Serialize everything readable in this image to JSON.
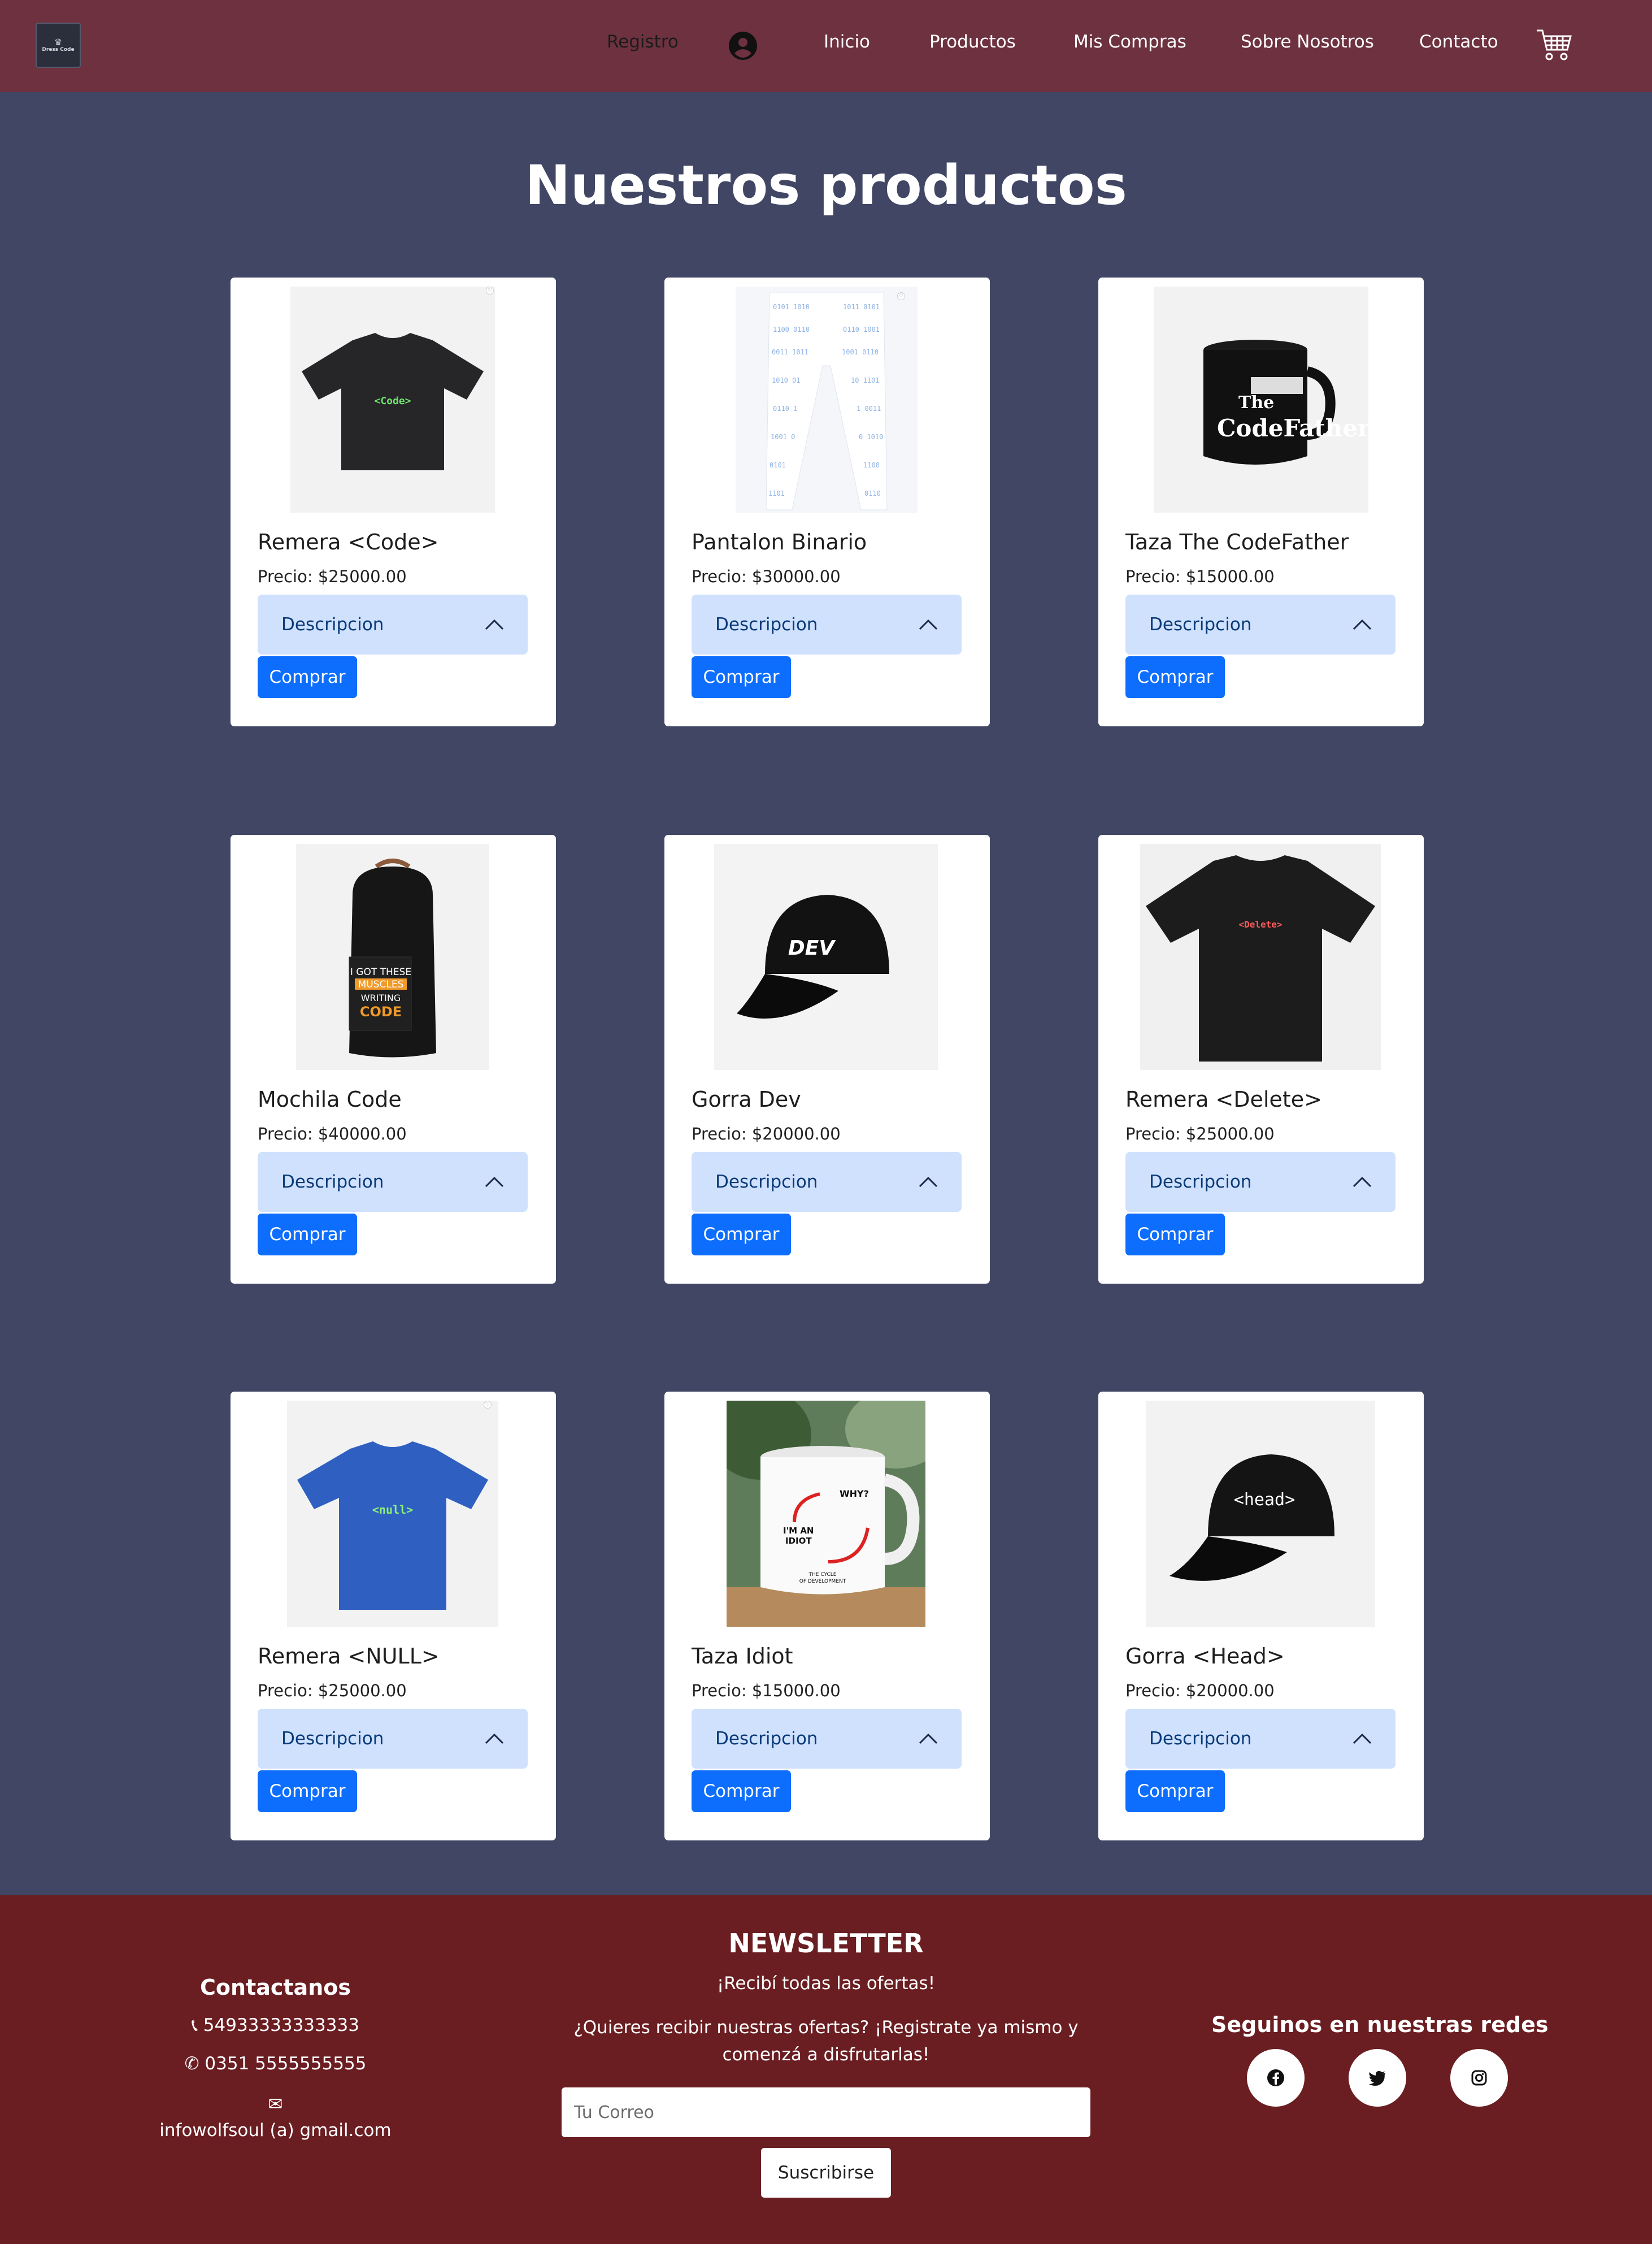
{
  "navbar": {
    "logo_text": "Dress Code",
    "items": [
      "Registro",
      "Inicio",
      "Productos",
      "Mis Compras",
      "Sobre Nosotros",
      "Contacto"
    ]
  },
  "page_title": "Nuestros productos",
  "products": [
    {
      "name": "Remera <Code>",
      "price": "Precio: $25000.00",
      "desc_label": "Descripcion",
      "buy_label": "Comprar",
      "image": "black-tshirt-code",
      "print": "<Code>"
    },
    {
      "name": "Pantalon Binario",
      "price": "Precio: $30000.00",
      "desc_label": "Descripcion",
      "buy_label": "Comprar",
      "image": "binary-pants",
      "print": ""
    },
    {
      "name": "Taza The CodeFather",
      "price": "Precio: $15000.00",
      "desc_label": "Descripcion",
      "buy_label": "Comprar",
      "image": "black-mug-codefather",
      "print": "The CodeFather"
    },
    {
      "name": "Mochila Code",
      "price": "Precio: $40000.00",
      "desc_label": "Descripcion",
      "buy_label": "Comprar",
      "image": "black-backpack",
      "print": "I GOT THESE MUSCLES WRITING CODE"
    },
    {
      "name": "Gorra Dev",
      "price": "Precio: $20000.00",
      "desc_label": "Descripcion",
      "buy_label": "Comprar",
      "image": "black-cap-dev",
      "print": "DEV"
    },
    {
      "name": "Remera <Delete>",
      "price": "Precio: $25000.00",
      "desc_label": "Descripcion",
      "buy_label": "Comprar",
      "image": "black-tshirt-delete",
      "print": "<Delete>"
    },
    {
      "name": "Remera <NULL>",
      "price": "Precio: $25000.00",
      "desc_label": "Descripcion",
      "buy_label": "Comprar",
      "image": "blue-tshirt-null",
      "print": "<null>"
    },
    {
      "name": "Taza Idiot",
      "price": "Precio: $15000.00",
      "desc_label": "Descripcion",
      "buy_label": "Comprar",
      "image": "white-mug-idiot",
      "print": "WHY? I'M AN IDIOT THE CYCLE OF DEVELOPMENT"
    },
    {
      "name": "Gorra <Head>",
      "price": "Precio: $20000.00",
      "desc_label": "Descripcion",
      "buy_label": "Comprar",
      "image": "black-cap-head",
      "print": "<head>"
    }
  ],
  "footer": {
    "contact": {
      "title": "Contactanos",
      "phone": "54933333333333",
      "whatsapp": "0351 5555555555",
      "email": "infowolfsoul (a) gmail.com"
    },
    "newsletter": {
      "title": "NEWSLETTER",
      "subtitle": "¡Recibí todas las ofertas!",
      "text": "¿Quieres recibir nuestras ofertas? ¡Registrate ya mismo y comenzá a disfrutarlas!",
      "placeholder": "Tu Correo",
      "button": "Suscribirse"
    },
    "social": {
      "title": "Seguinos en nuestras redes",
      "icons": [
        "facebook-icon",
        "twitter-icon",
        "instagram-icon"
      ]
    }
  },
  "colors": {
    "navbar": "#6d3140",
    "background": "#404664",
    "footer": "#6a1e22",
    "primary": "#0d6efd",
    "accordion": "#cfe1fd"
  }
}
